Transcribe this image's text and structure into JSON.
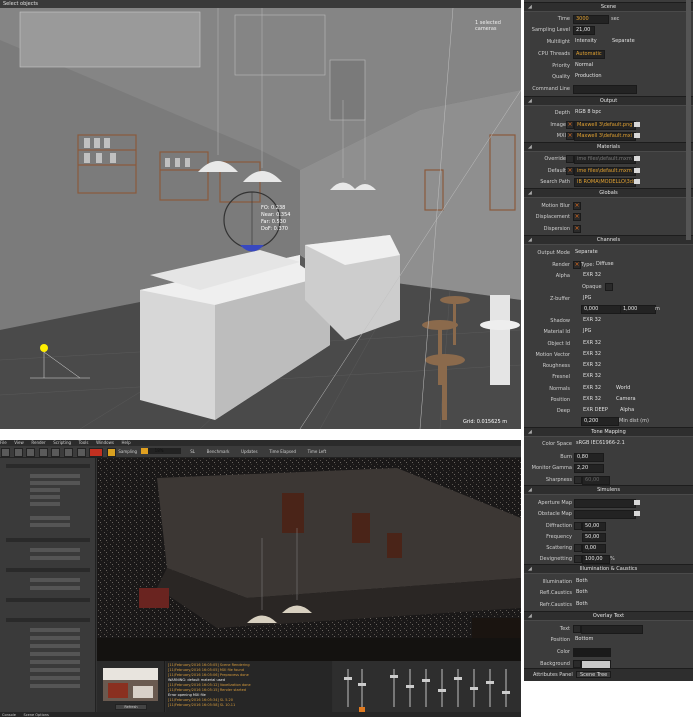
{
  "viewport": {
    "status": "Select objects",
    "cameras": "1 selected cameras",
    "camera_info": [
      "FO: 0.238",
      "Near: 0.354",
      "Far: 0.530",
      "DoF: 0.370"
    ],
    "grid": "Grid: 0.015625 m"
  },
  "panel": {
    "sections": {
      "scene": "Scene",
      "output": "Output",
      "materials": "Materials",
      "globals": "Globals",
      "channels": "Channels",
      "tone_mapping": "Tone Mapping",
      "simulens": "Simulens",
      "illumination": "Illumination & Caustics",
      "overlay": "Overlay Text"
    },
    "scene": {
      "time_label": "Time",
      "time_value": "3000",
      "time_unit": "sec",
      "sampling_label": "Sampling Level",
      "sampling_value": "21,00",
      "multilight_label": "Multilight",
      "multilight_a": "Intensity",
      "multilight_b": "Separate",
      "cpu_label": "CPU Threads",
      "cpu_value": "Automatic",
      "priority_label": "Priority",
      "priority_value": "Normal",
      "quality_label": "Quality",
      "quality_value": "Production",
      "command_label": "Command Line"
    },
    "output": {
      "depth_label": "Depth",
      "depth_value": "RGB 8 bpc",
      "image_label": "Image",
      "image_value": "Maxwell 3\\default.png",
      "mxi_label": "MXI",
      "mxi_value": "Maxwell 3\\default.mxi"
    },
    "materials": {
      "override_label": "Override",
      "override_value": "ime files\\default.mxm",
      "default_label": "Default",
      "default_value": "ime files\\default.mxm",
      "search_label": "Search Path",
      "search_value": "IB ROMA\\MODELLO\\3ds\\"
    },
    "globals": {
      "motion_label": "Motion Blur",
      "displacement_label": "Displacement",
      "dispersion_label": "Dispersion"
    },
    "channels": {
      "output_mode_label": "Output Mode",
      "output_mode_value": "Separate",
      "render_label": "Render",
      "render_type": "Type:",
      "render_type_value": "Diffuse",
      "alpha_label": "Alpha",
      "alpha_value": "EXR 32",
      "opaque_label": "Opaque",
      "zbuffer_label": "Z-buffer",
      "zbuffer_value": "JPG",
      "z_min": "0,000",
      "z_max": "1,000",
      "z_unit": "m",
      "shadow_label": "Shadow",
      "shadow_value": "EXR 32",
      "material_id_label": "Material Id",
      "material_id_value": "JPG",
      "object_id_label": "Object Id",
      "object_id_value": "EXR 32",
      "motion_vector_label": "Motion Vector",
      "motion_vector_value": "EXR 32",
      "roughness_label": "Roughness",
      "roughness_value": "EXR 32",
      "fresnel_label": "Fresnel",
      "fresnel_value": "EXR 32",
      "normals_label": "Normals",
      "normals_value": "EXR 32",
      "normals_space": "World",
      "position_label": "Position",
      "position_value": "EXR 32",
      "position_space": "Camera",
      "deep_label": "Deep",
      "deep_value": "EXR DEEP",
      "deep_mode": "Alpha",
      "min_dist_value": "0,200",
      "min_dist_label": "Min dist (m)"
    },
    "tone": {
      "color_space_label": "Color Space",
      "color_space_value": "sRGB IEC61966-2.1",
      "burn_label": "Burn",
      "burn_value": "0,80",
      "gamma_label": "Monitor Gamma",
      "gamma_value": "2,20",
      "sharpness_label": "Sharpness",
      "sharpness_value": "60,00"
    },
    "simulens": {
      "aperture_label": "Aperture Map",
      "obstacle_label": "Obstacle Map",
      "diffraction_label": "Diffraction",
      "diffraction_value": "50,00",
      "frequency_label": "Frequency",
      "frequency_value": "50,00",
      "scattering_label": "Scattering",
      "scattering_value": "0,00",
      "devignetting_label": "Devignetting",
      "devignetting_value": "100,00",
      "devignetting_unit": "%"
    },
    "illumination": {
      "illum_label": "Illumination",
      "illum_value": "Both",
      "refl_label": "Refl.Caustics",
      "refl_value": "Both",
      "refr_label": "Refr.Caustics",
      "refr_value": "Both"
    },
    "overlay": {
      "text_label": "Text",
      "position_label": "Position",
      "position_value": "Bottom",
      "color_label": "Color",
      "background_label": "Background"
    },
    "footer": {
      "attributes_label": "Attributes Panel",
      "scene_tree_tab": "Scene Tree"
    },
    "colors": {
      "background_swatch": "#c8c8c8",
      "color_swatch": "#1a1a1a",
      "accent": "#e26a1a"
    }
  },
  "app": {
    "menu": [
      "File",
      "View",
      "Render",
      "Scripting",
      "Tools",
      "Windows",
      "Help"
    ],
    "sampling_label": "Sampling",
    "sampling_value": "18%",
    "benchmark_label": "Benchmark",
    "updates_label": "Updates",
    "time_elapsed_label": "Time Elapsed",
    "time_left_label": "Time Left",
    "sl_label": "SL",
    "console_lines": [
      "[11/February/2016 16:05:05] Scene Rendering",
      "[11/February/2016 16:05:05] MXI file found",
      "[11/February/2016 16:05:06] Preprocess done",
      "WARNING: default material used",
      "[11/February/2016 16:05:12] Voxelization done",
      "[11/February/2016 16:05:15] Render started",
      "Error opening MXI file",
      "[11/February/2016 16:05:34] SL 5.20",
      "[11/February/2016 16:05:58] SL 10.11"
    ],
    "preview_button": "Refresh",
    "status_tabs": [
      "Console",
      "Scene Options"
    ]
  }
}
